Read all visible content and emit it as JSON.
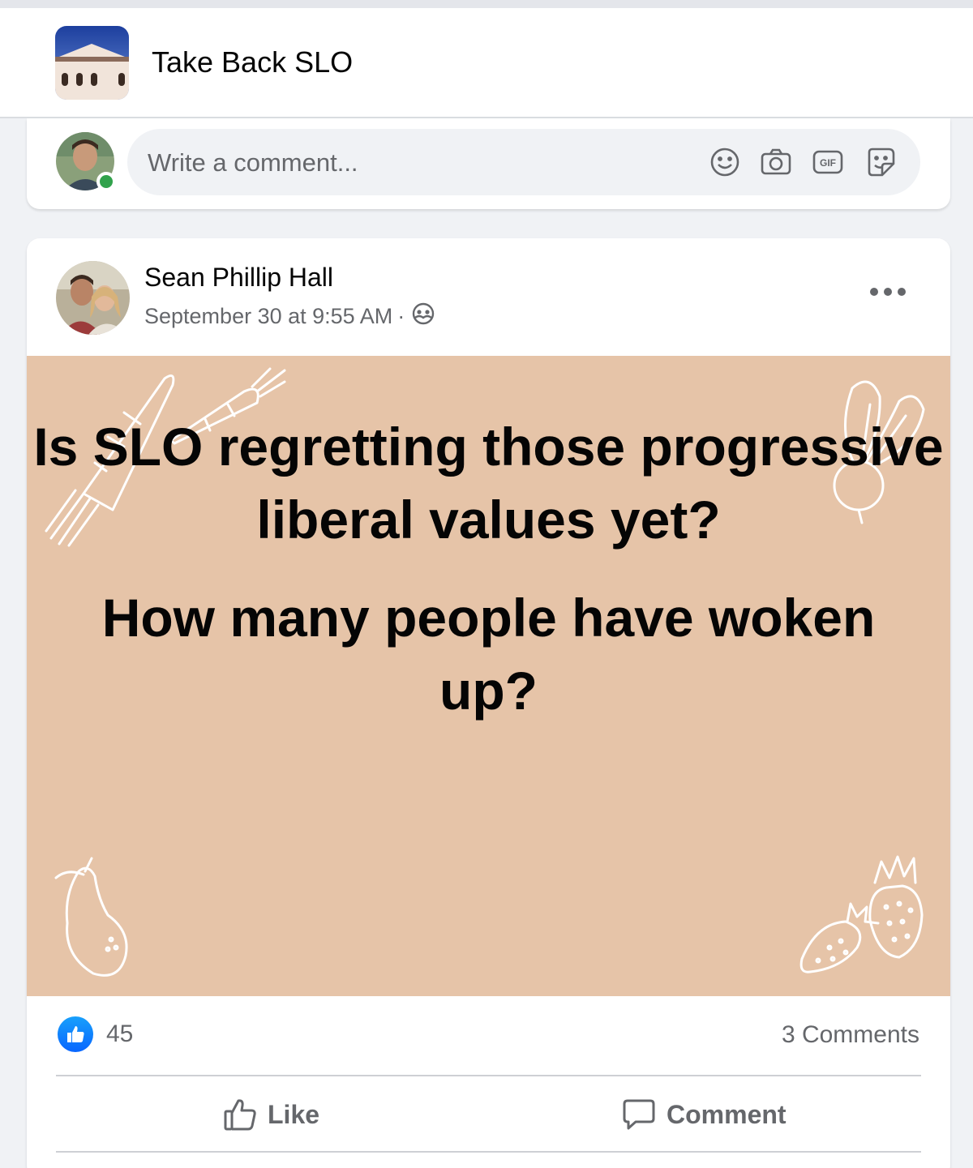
{
  "group": {
    "name": "Take Back SLO"
  },
  "composer": {
    "placeholder": "Write a comment...",
    "icons": [
      "emoji-icon",
      "camera-icon",
      "gif-icon",
      "sticker-icon"
    ]
  },
  "post": {
    "author": "Sean Phillip Hall",
    "timestamp": "September 30 at 9:55 AM",
    "separator": "·",
    "audience_icon": "group-audience-icon",
    "text_line1": "Is SLO regretting those progressive liberal values yet?",
    "text_line2": "How many people have woken up?",
    "background_color": "#e6c4a8"
  },
  "engagement": {
    "reaction_count": "45",
    "comments_label": "3 Comments"
  },
  "actions": {
    "like_label": "Like",
    "comment_label": "Comment"
  },
  "colors": {
    "like_blue": "#0866ff",
    "secondary_text": "#65676b",
    "online_green": "#31a24c"
  }
}
